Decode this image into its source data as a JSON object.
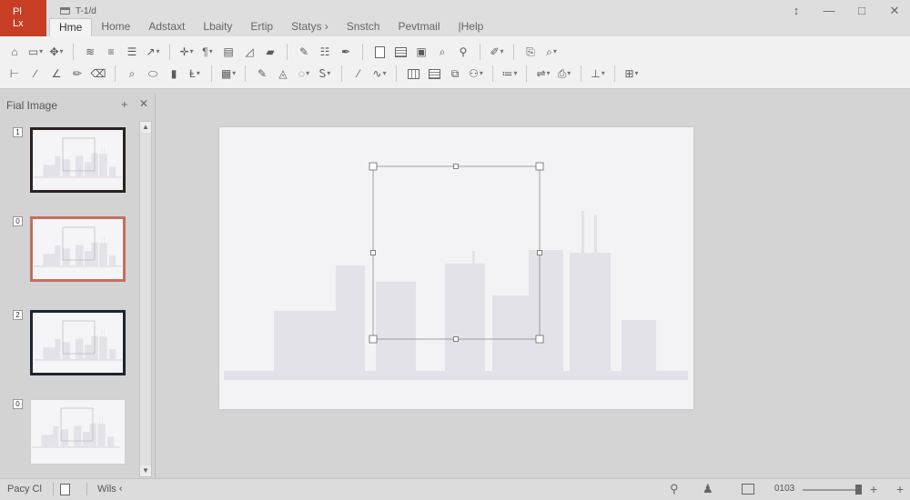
{
  "app": {
    "logo_line1": "Pl",
    "logo_line2": "Lx",
    "doc_title": "T-1/d"
  },
  "tabs": [
    {
      "label": "Hme",
      "active": true
    },
    {
      "label": "Home"
    },
    {
      "label": "Adstaxt"
    },
    {
      "label": "Lbaity"
    },
    {
      "label": "Ertip"
    },
    {
      "label": "Statys ›"
    },
    {
      "label": "Snstch"
    },
    {
      "label": "Pevtmail"
    },
    {
      "label": "|Help"
    }
  ],
  "window_controls": {
    "restore": "↕",
    "minimize": "—",
    "maximize": "□",
    "close": "✕"
  },
  "ribbon": {
    "row1": [
      "home-icon",
      "select-icon",
      "select-tool-icon",
      "sep",
      "wifi-icon",
      "align-left-icon",
      "align-center-icon",
      "cursor-icon",
      "sep",
      "move-icon",
      "format-icon",
      "format-table-icon",
      "edit-shape-icon",
      "highlight-icon",
      "sep",
      "edit-doc-icon",
      "list-icon",
      "pen-icon",
      "sep",
      "doc-icon",
      "list-doc-icon",
      "image-icon",
      "search-icon",
      "zoom-icon",
      "sep",
      "pencil-icon",
      "sep",
      "copy-icon",
      "find-icon"
    ],
    "row2": [
      "line-icon",
      "diagonal-icon",
      "angle-icon",
      "pencil-tool-icon",
      "eraser-icon",
      "sep",
      "magnify-icon",
      "paint-icon",
      "shapes-icon",
      "text-icon",
      "sep",
      "chart-icon",
      "sep",
      "marker-icon",
      "fill-icon",
      "clip-icon",
      "font-color-icon",
      "sep",
      "brush-icon",
      "curve-icon",
      "sep",
      "table-icon",
      "text-block-icon",
      "shape-copy-icon",
      "person-icon",
      "sep",
      "rows-icon",
      "sep",
      "link-icon",
      "copy-format-icon",
      "sep",
      "align-icon",
      "sep",
      "group-icon"
    ],
    "glyphs": {
      "home-icon": "⌂",
      "select-icon": "▭",
      "select-tool-icon": "✥",
      "wifi-icon": "≋",
      "align-left-icon": "≡",
      "align-center-icon": "☰",
      "cursor-icon": "↗",
      "move-icon": "✛",
      "format-icon": "¶",
      "format-table-icon": "▤",
      "edit-shape-icon": "◿",
      "highlight-icon": "▰",
      "edit-doc-icon": "✎",
      "list-icon": "☷",
      "pen-icon": "✒",
      "doc-icon": "doc",
      "list-doc-icon": "lines",
      "image-icon": "▣",
      "search-icon": "⌕",
      "zoom-icon": "⚲",
      "pencil-icon": "✐",
      "copy-icon": "⎘",
      "find-icon": "⌕",
      "line-icon": "⊢",
      "diagonal-icon": "∕",
      "angle-icon": "∠",
      "pencil-tool-icon": "✏",
      "eraser-icon": "⌫",
      "magnify-icon": "⌕",
      "paint-icon": "⬭",
      "shapes-icon": "▮",
      "text-icon": "Ⱡ",
      "chart-icon": "▦",
      "marker-icon": "✎",
      "fill-icon": "◬",
      "clip-icon": "◌",
      "font-color-icon": "Ꮪ",
      "brush-icon": "⁄",
      "curve-icon": "∿",
      "table-icon": "grid",
      "text-block-icon": "lines",
      "shape-copy-icon": "⧉",
      "person-icon": "⚇",
      "rows-icon": "≔",
      "link-icon": "⇌",
      "copy-format-icon": "⎙",
      "align-icon": "⊥",
      "group-icon": "⊞"
    },
    "dropdown_icons": [
      "select-icon",
      "select-tool-icon",
      "cursor-icon",
      "move-icon",
      "format-icon",
      "text-icon",
      "chart-icon",
      "clip-icon",
      "font-color-icon",
      "curve-icon",
      "person-icon",
      "rows-icon",
      "copy-format-icon",
      "pencil-icon",
      "find-icon",
      "group-icon",
      "align-icon",
      "link-icon"
    ]
  },
  "thumb_pane": {
    "title": "Fial Image",
    "pin": "+",
    "close": "✕",
    "scroll_up": "▲",
    "scroll_down": "▼",
    "slides": [
      {
        "number": "1",
        "border_color": "#2a2220"
      },
      {
        "number": "0",
        "border_color": "#c07060"
      },
      {
        "number": "2",
        "border_color": "#1e2430"
      },
      {
        "number": "0",
        "border_color": "#d0d0d0"
      }
    ]
  },
  "slide": {
    "skyline_color": "#e2e2e8",
    "selection_color": "#8a8a8a"
  },
  "status": {
    "page": "Pacy Cl",
    "words": "Wils ‹",
    "zoom_text": "0103",
    "zoom_in": "+",
    "zoom_out": "+",
    "hint_icon": "⚲",
    "user_icon": "♟"
  }
}
